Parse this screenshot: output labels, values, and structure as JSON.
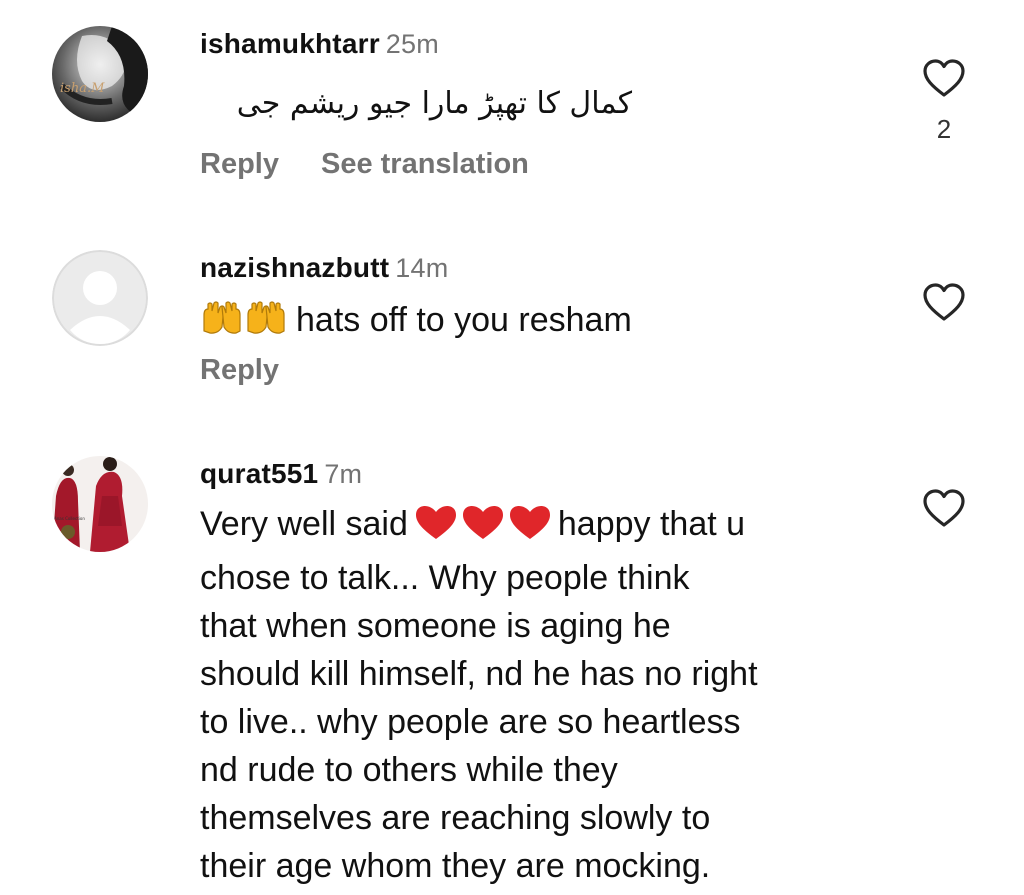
{
  "colors": {
    "text": "#111111",
    "muted": "#737373",
    "heart_red": "#e0262a",
    "hands_yellow": "#f6b21a"
  },
  "comments": [
    {
      "username": "ishamukhtarr",
      "time": "25m",
      "text": "کمال کا تھپڑ مارا جیو ریشم جی",
      "reply_label": "Reply",
      "translate_label": "See translation",
      "like_count": "2",
      "avatar_signature": "isha M"
    },
    {
      "username": "nazishnazbutt",
      "time": "14m",
      "emoji": "🙌🙌",
      "text": "hats off to you resham",
      "reply_label": "Reply"
    },
    {
      "username": "qurat551",
      "time": "7m",
      "lines": [
        {
          "before": "Very well said",
          "emoji": "❤️❤️❤️",
          "after": "happy that u"
        },
        "chose to talk... Why people think",
        "that when someone is aging he",
        "should kill himself, nd he has no right",
        "to live.. why people are so heartless",
        "nd rude to others while they",
        "themselves are reaching slowly to",
        "their age whom they are mocking."
      ]
    }
  ]
}
